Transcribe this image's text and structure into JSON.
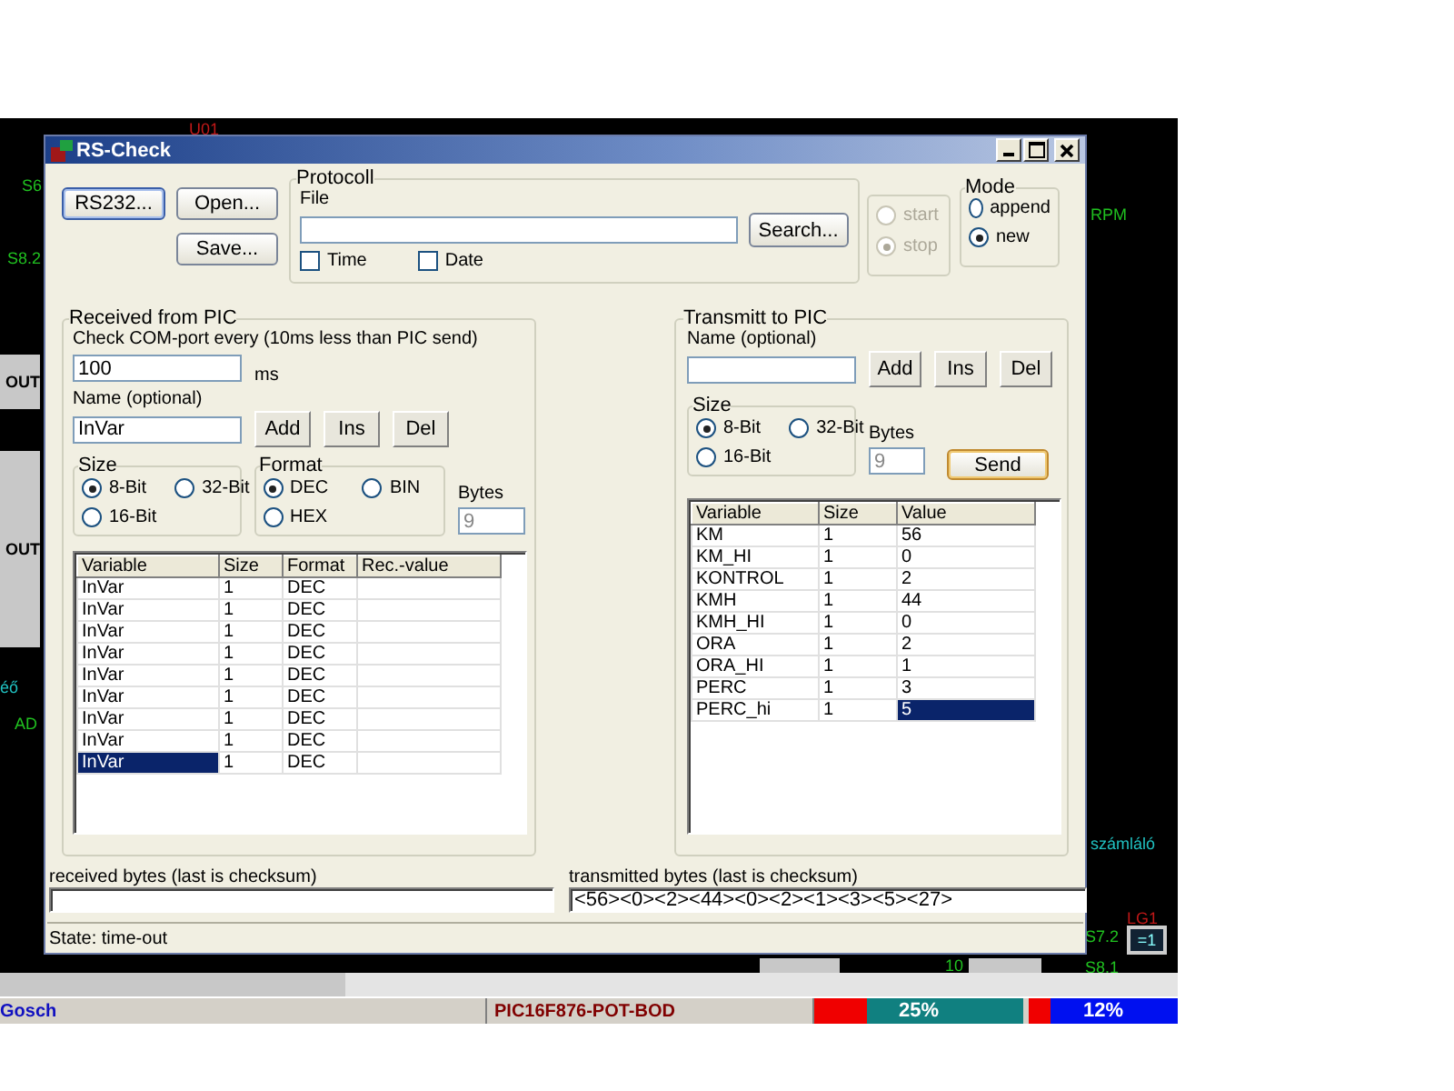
{
  "canvas_labels": [
    {
      "text": "U01",
      "color": "#c01818"
    },
    {
      "text": "S6",
      "color": "#20c020"
    },
    {
      "text": "S8.2",
      "color": "#20c020"
    },
    {
      "text": "RPM",
      "color": "#20c020"
    },
    {
      "text": "éő",
      "color": "#20c0c0"
    },
    {
      "text": "AD",
      "color": "#20c020"
    },
    {
      "text": "számláló",
      "color": "#20c0c0"
    },
    {
      "text": "LG1",
      "color": "#c01818"
    },
    {
      "text": "S7.2",
      "color": "#20c020"
    },
    {
      "text": "S8.1",
      "color": "#20c020"
    },
    {
      "text": "10",
      "color": "#20c020"
    }
  ],
  "canvas_blocks": [
    {
      "text": "OUT"
    },
    {
      "text": "OUT"
    }
  ],
  "gate": {
    "text": "=1"
  },
  "window": {
    "title": "RS-Check"
  },
  "toolbar": {
    "buttons": [
      "RS232...",
      "Open...",
      "Save..."
    ]
  },
  "protocol": {
    "title": "Protocoll",
    "file_label": "File",
    "search_button": "Search...",
    "options": [
      {
        "label": "Time",
        "checked": false
      },
      {
        "label": "Date",
        "checked": false
      }
    ]
  },
  "run": {
    "options": [
      {
        "label": "start",
        "selected": false,
        "disabled": true
      },
      {
        "label": "stop",
        "selected": true,
        "disabled": true
      }
    ]
  },
  "mode": {
    "title": "Mode",
    "options": [
      {
        "label": "append",
        "selected": false
      },
      {
        "label": "new",
        "selected": true
      }
    ]
  },
  "received": {
    "title": "Received from PIC",
    "interval_label": "Check COM-port every (10ms less than PIC send)",
    "interval": "100",
    "unit": "ms",
    "name_label": "Name (optional)",
    "name": "InVar",
    "buttons": [
      "Add",
      "Ins",
      "Del"
    ],
    "size": {
      "title": "Size",
      "options": [
        {
          "label": "8-Bit",
          "selected": true
        },
        {
          "label": "32-Bit",
          "selected": false
        },
        {
          "label": "16-Bit",
          "selected": false
        }
      ]
    },
    "format": {
      "title": "Format",
      "options": [
        {
          "label": "DEC",
          "selected": true
        },
        {
          "label": "BIN",
          "selected": false
        },
        {
          "label": "HEX",
          "selected": false
        }
      ]
    },
    "bytes_label": "Bytes",
    "bytes": "9",
    "table": {
      "columns": [
        "Variable",
        "Size",
        "Format",
        "Rec.-value"
      ],
      "rows": [
        {
          "variable": "InVar",
          "size": "1",
          "format": "DEC",
          "selected": false
        },
        {
          "variable": "InVar",
          "size": "1",
          "format": "DEC",
          "selected": false
        },
        {
          "variable": "InVar",
          "size": "1",
          "format": "DEC",
          "selected": false
        },
        {
          "variable": "InVar",
          "size": "1",
          "format": "DEC",
          "selected": false
        },
        {
          "variable": "InVar",
          "size": "1",
          "format": "DEC",
          "selected": false
        },
        {
          "variable": "InVar",
          "size": "1",
          "format": "DEC",
          "selected": false
        },
        {
          "variable": "InVar",
          "size": "1",
          "format": "DEC",
          "selected": false
        },
        {
          "variable": "InVar",
          "size": "1",
          "format": "DEC",
          "selected": false
        },
        {
          "variable": "InVar",
          "size": "1",
          "format": "DEC",
          "selected": true
        }
      ]
    }
  },
  "transmit": {
    "title": "Transmitt to PIC",
    "name_label": "Name (optional)",
    "buttons": [
      "Add",
      "Ins",
      "Del"
    ],
    "size": {
      "title": "Size",
      "options": [
        {
          "label": "8-Bit",
          "selected": true
        },
        {
          "label": "32-Bit",
          "selected": false
        },
        {
          "label": "16-Bit",
          "selected": false
        }
      ]
    },
    "bytes_label": "Bytes",
    "bytes": "9",
    "send_button": "Send",
    "table": {
      "columns": [
        "Variable",
        "Size",
        "Value"
      ],
      "rows": [
        {
          "variable": "KM",
          "size": "1",
          "value": "56",
          "selected": false
        },
        {
          "variable": "KM_HI",
          "size": "1",
          "value": "0",
          "selected": false
        },
        {
          "variable": "KONTROL",
          "size": "1",
          "value": "2",
          "selected": false
        },
        {
          "variable": "KMH",
          "size": "1",
          "value": "44",
          "selected": false
        },
        {
          "variable": "KMH_HI",
          "size": "1",
          "value": "0",
          "selected": false
        },
        {
          "variable": "ORA",
          "size": "1",
          "value": "2",
          "selected": false
        },
        {
          "variable": "ORA_HI",
          "size": "1",
          "value": "1",
          "selected": false
        },
        {
          "variable": "PERC",
          "size": "1",
          "value": "3",
          "selected": false
        },
        {
          "variable": "PERC_hi",
          "size": "1",
          "value": "5",
          "selected": true
        }
      ]
    }
  },
  "received_bytes": {
    "label": "received bytes (last is checksum)"
  },
  "transmitted_bytes": {
    "label": "transmitted bytes (last is checksum)",
    "value": "<56><0><2><44><0><2><1><3><5><27>"
  },
  "status": "State: time-out",
  "app_status": {
    "user": "Gosch",
    "device": "PIC16F876-POT-BOD",
    "meters": [
      {
        "reading": "25%",
        "level": 0.25,
        "color": "#108080"
      },
      {
        "reading": "12%",
        "level": 0.15,
        "color": "#0010f0"
      }
    ]
  }
}
